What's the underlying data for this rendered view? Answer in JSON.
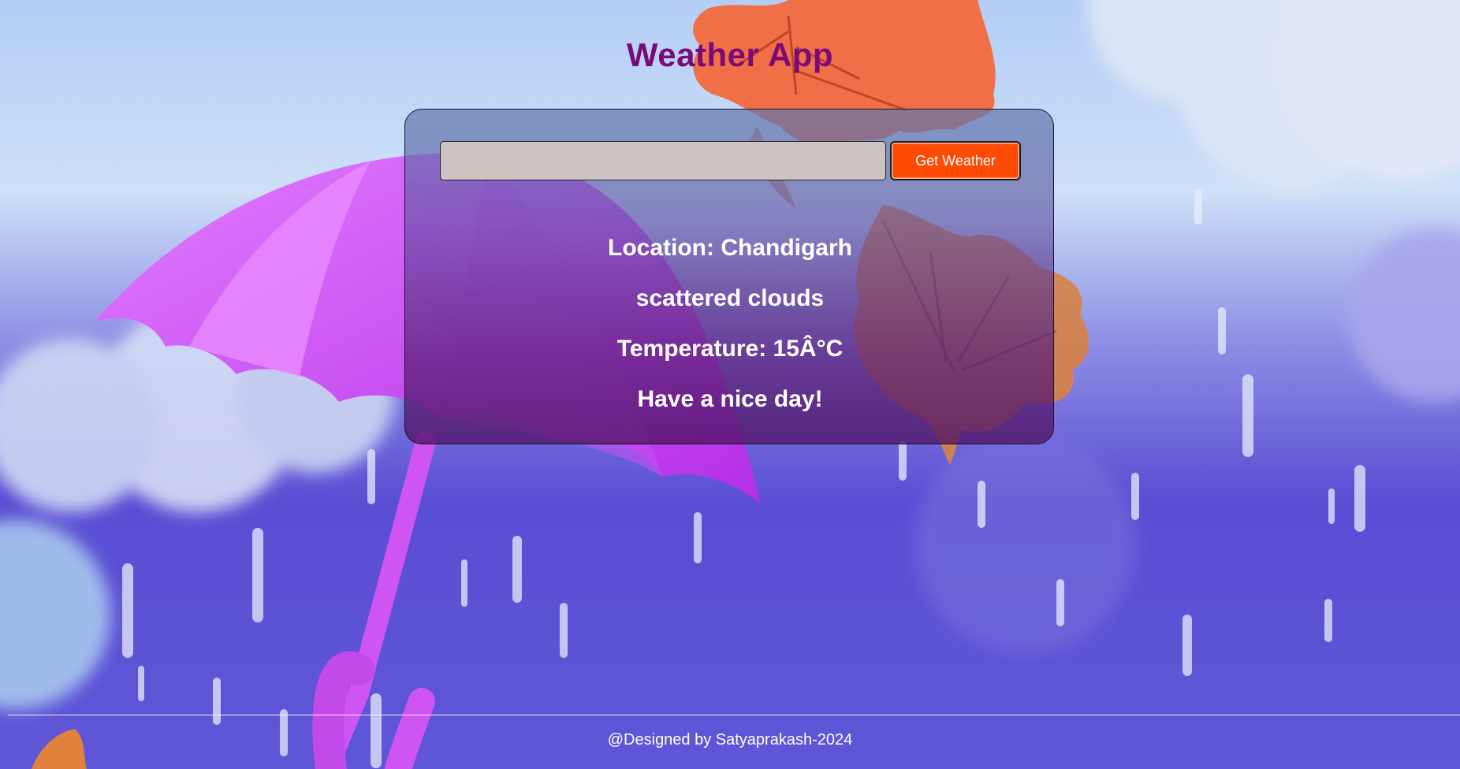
{
  "app": {
    "title": "Weather App"
  },
  "search": {
    "value": "",
    "placeholder": "",
    "button_label": "Get Weather"
  },
  "weather": {
    "location": "Location: Chandigarh",
    "description": "scattered clouds",
    "temperature": "Temperature: 15Â°C",
    "message": "Have a nice day!"
  },
  "footer": {
    "credit": "@Designed by Satyaprakash-2024"
  },
  "colors": {
    "title": "#7a0a78",
    "button": "#fd4b06",
    "input_bg": "#cdc3c3",
    "text": "#ffffff"
  },
  "background": {
    "illustration": "rain-umbrella-autumn-leaves"
  }
}
